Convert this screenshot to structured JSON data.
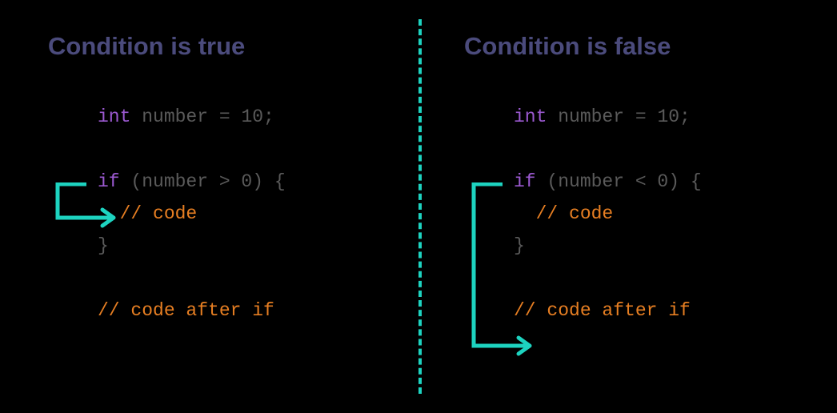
{
  "left": {
    "title": "Condition is true",
    "line1": {
      "kw": "int",
      "rest": " number = 10;"
    },
    "line2": {
      "kw": "if",
      "rest": " (number > 0) {"
    },
    "line3": {
      "comment": "// code"
    },
    "line4": "}",
    "line5": {
      "comment": "// code after if"
    }
  },
  "right": {
    "title": "Condition is false",
    "line1": {
      "kw": "int",
      "rest": " number = 10;"
    },
    "line2": {
      "kw": "if",
      "rest": " (number < 0) {"
    },
    "line3": {
      "comment": "// code"
    },
    "line4": "}",
    "line5": {
      "comment": "// code after if"
    }
  }
}
